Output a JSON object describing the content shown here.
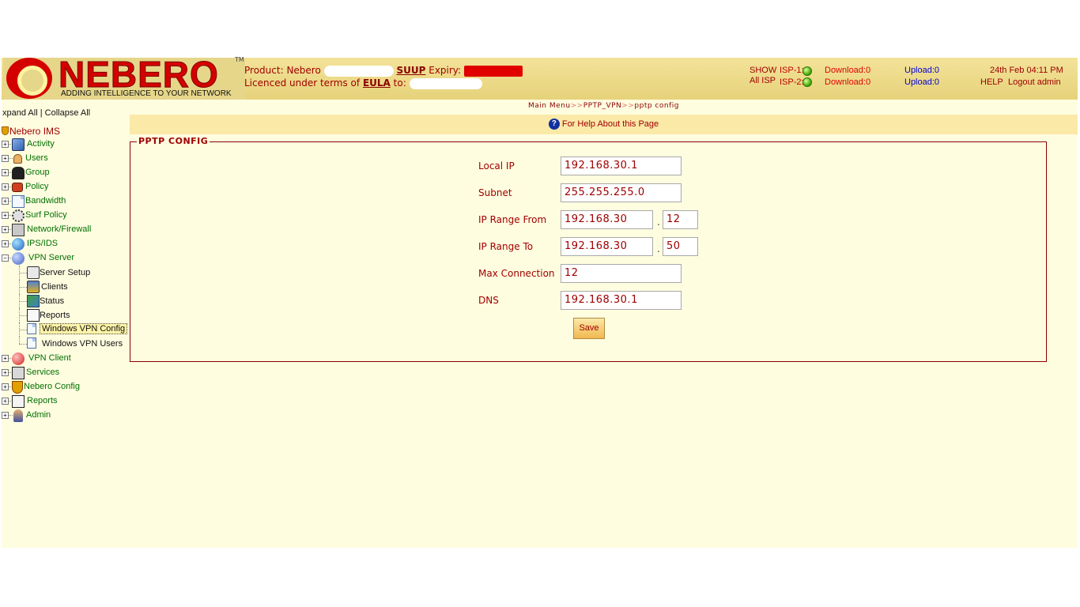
{
  "header": {
    "logo_text": "NEBERO",
    "logo_tm": "TM",
    "tagline": "ADDING INTELLIGENCE TO YOUR NETWORK",
    "product_label": "Product:",
    "product_name": "Nebero",
    "suup": "SUUP",
    "expiry_label": "Expiry:",
    "licence_text": "Licenced under terms of",
    "eula": "EULA",
    "to_label": "to:",
    "show_all_isp_line1": "SHOW",
    "show_all_isp_line2": "All ISP",
    "isps": [
      {
        "label": "ISP-1:",
        "download": "Download:0",
        "upload": "Upload:0"
      },
      {
        "label": "ISP-2:",
        "download": "Download:0",
        "upload": "Upload:0"
      }
    ],
    "datetime": "24th Feb 04:11 PM",
    "help": "HELP",
    "logout": "Logout admin"
  },
  "sidebar": {
    "expand_all": "xpand All",
    "divider": "|",
    "collapse_all": "Collapse All",
    "root": "Nebero IMS",
    "nodes": [
      {
        "label": "Activity",
        "icon": "activity-icon",
        "pm": "+"
      },
      {
        "label": "Users",
        "icon": "users-icon",
        "pm": "+"
      },
      {
        "label": "Group",
        "icon": "group-icon",
        "pm": "+"
      },
      {
        "label": "Policy",
        "icon": "policy-icon",
        "pm": "+"
      },
      {
        "label": "Bandwidth",
        "icon": "bandwidth-icon",
        "pm": "+"
      },
      {
        "label": "Surf Policy",
        "icon": "gear-icon",
        "pm": "+"
      },
      {
        "label": "Network/Firewall",
        "icon": "firewall-icon",
        "pm": "+"
      },
      {
        "label": "IPS/IDS",
        "icon": "globe-icon",
        "pm": "+"
      },
      {
        "label": "VPN Server",
        "icon": "vpn-server-icon",
        "pm": "−"
      }
    ],
    "vpn_children": [
      {
        "label": "Server Setup",
        "icon": "server-setup-icon"
      },
      {
        "label": "Clients",
        "icon": "clients-icon"
      },
      {
        "label": "Status",
        "icon": "status-icon"
      },
      {
        "label": "Reports",
        "icon": "reports-icon"
      },
      {
        "label": "Windows VPN Config",
        "icon": "page-icon"
      },
      {
        "label": "Windows VPN Users",
        "icon": "page-icon"
      }
    ],
    "nodes_after": [
      {
        "label": "VPN Client",
        "icon": "vpn-client-icon",
        "pm": "+"
      },
      {
        "label": "Services",
        "icon": "services-icon",
        "pm": "+"
      },
      {
        "label": "Nebero Config",
        "icon": "shield-icon",
        "pm": "+"
      },
      {
        "label": "Reports",
        "icon": "reports-icon",
        "pm": "+"
      },
      {
        "label": "Admin",
        "icon": "admin-icon",
        "pm": "+"
      }
    ]
  },
  "main": {
    "breadcrumb": [
      "Main Menu",
      ">>",
      "PPTP_VPN",
      ">>",
      "pptp config"
    ],
    "help_text": "For Help About this Page",
    "legend": "PPTP CONFIG",
    "fields": {
      "local_ip": {
        "label": "Local IP",
        "value": "192.168.30.1"
      },
      "subnet": {
        "label": "Subnet",
        "value": "255.255.255.0"
      },
      "range_from": {
        "label": "IP Range From",
        "value": "192.168.30",
        "suffix": "12"
      },
      "range_to": {
        "label": "IP Range To",
        "value": "192.168.30",
        "suffix": "50"
      },
      "max_connection": {
        "label": "Max Connection",
        "value": "12"
      },
      "dns": {
        "label": "DNS",
        "value": "192.168.30.1"
      }
    },
    "range_separator": ".",
    "save_label": "Save"
  }
}
